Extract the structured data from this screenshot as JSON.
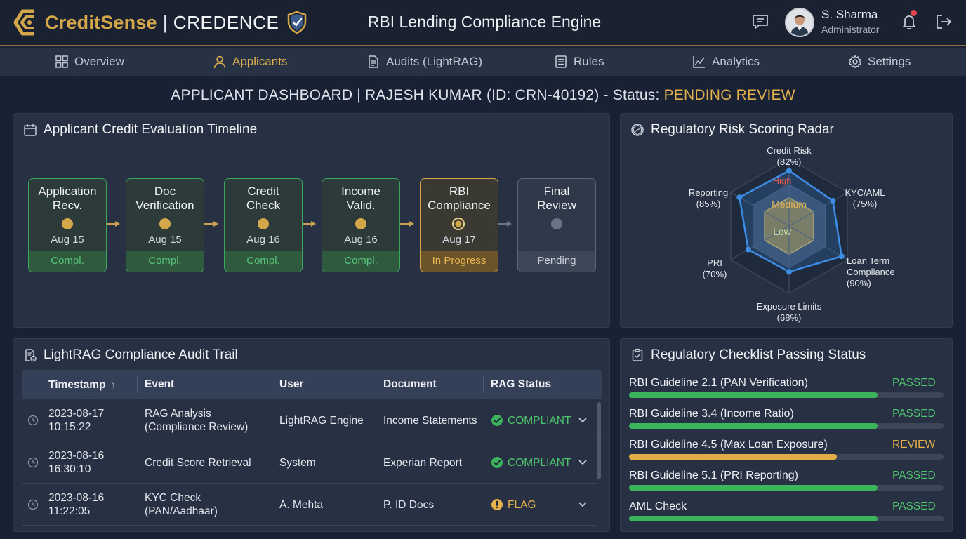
{
  "header": {
    "brand_name": "CreditSense",
    "brand_sep": "|",
    "brand_sub": "CREDENCE",
    "app_title": "RBI Lending Compliance Engine",
    "user_name": "S. Sharma",
    "user_role": "Administrator",
    "icons": [
      "chat-icon",
      "bell-icon",
      "logout-icon"
    ]
  },
  "nav": {
    "active": "Applicants",
    "items": [
      {
        "label": "Overview",
        "icon": "grid-icon"
      },
      {
        "label": "Applicants",
        "icon": "user-icon"
      },
      {
        "label": "Audits (LightRAG)",
        "icon": "document-icon"
      },
      {
        "label": "Rules",
        "icon": "list-icon"
      },
      {
        "label": "Analytics",
        "icon": "chart-icon"
      },
      {
        "label": "Settings",
        "icon": "gear-icon"
      }
    ]
  },
  "page": {
    "heading_prefix": "APPLICANT DASHBOARD |  RAJESH KUMAR (ID: CRN-40192) - Status:",
    "status_value": "PENDING REVIEW"
  },
  "timeline": {
    "title": "Applicant Credit Evaluation Timeline",
    "steps": [
      {
        "label1": "Application",
        "label2": "Recv.",
        "date": "Aug 15",
        "status": "Compl."
      },
      {
        "label1": "Doc",
        "label2": "Verification",
        "date": "Aug 15",
        "status": "Compl."
      },
      {
        "label1": "Credit",
        "label2": "Check",
        "date": "Aug 16",
        "status": "Compl."
      },
      {
        "label1": "Income",
        "label2": "Valid.",
        "date": "Aug 16",
        "status": "Compl."
      },
      {
        "label1": "RBI",
        "label2": "Compliance",
        "date": "Aug 17",
        "status": "In Progress"
      },
      {
        "label1": "Final",
        "label2": "Review",
        "date": "",
        "status": "Pending"
      }
    ],
    "colors": {
      "complete": "#3aa65e",
      "progress": "#d8a64c",
      "pending": "#5d6676"
    }
  },
  "radar": {
    "title": "Regulatory Risk Scoring Radar",
    "zone_labels": {
      "high": "High",
      "medium": "Medium",
      "low": "Low"
    },
    "axes": [
      {
        "name": "Credit Risk",
        "value_text": "(82%)",
        "value": 82
      },
      {
        "name": "KYC/AML",
        "value_text": "(75%)",
        "value": 75
      },
      {
        "name": "Loan Term Compliance",
        "name_lines": [
          "Loan Term",
          "Compliance"
        ],
        "value_text": "(90%)",
        "value": 90
      },
      {
        "name": "Exposure Limits",
        "value_text": "(68%)",
        "value": 68
      },
      {
        "name": "PRI",
        "value_text": "(70%)",
        "value": 70
      },
      {
        "name": "Reporting",
        "value_text": "(85%)",
        "value": 85
      }
    ],
    "colors": {
      "series": "#3d8ce6",
      "low": "#8c7a45",
      "medium": "#3a4a60",
      "high": "#1f2a3c"
    }
  },
  "audit": {
    "title": "LightRAG Compliance Audit Trail",
    "columns": [
      "Timestamp",
      "Event",
      "User",
      "Document",
      "RAG Status"
    ],
    "sort_indicator": "↑",
    "rows": [
      {
        "date": "2023-08-17",
        "time": "10:15:22",
        "event1": "RAG Analysis",
        "event2": "(Compliance Review)",
        "user": "LightRAG Engine",
        "document": "Income Statements",
        "status": "COMPLIANT",
        "kind": "ok"
      },
      {
        "date": "2023-08-16",
        "time": "16:30:10",
        "event1": "Credit Score Retrieval",
        "event2": "",
        "user": "System",
        "document": "Experian Report",
        "status": "COMPLIANT",
        "kind": "ok"
      },
      {
        "date": "2023-08-16",
        "time": "11:22:05",
        "event1": "KYC Check",
        "event2": "(PAN/Aadhaar)",
        "user": "A. Mehta",
        "document": "P. ID Docs",
        "status": "FLAG",
        "kind": "flag"
      }
    ]
  },
  "checklist": {
    "title": "Regulatory Checklist Passing Status",
    "items": [
      {
        "name": "RBI Guideline 2.1 (PAN Verification)",
        "status": "PASSED",
        "progress": 0.79
      },
      {
        "name": "RBI Guideline 3.4 (Income Ratio)",
        "status": "PASSED",
        "progress": 0.79
      },
      {
        "name": "RBI Guideline 4.5 (Max Loan Exposure)",
        "status": "REVIEW",
        "progress": 0.66
      },
      {
        "name": "RBI Guideline 5.1 (PRI Reporting)",
        "status": "PASSED",
        "progress": 0.79
      },
      {
        "name": "AML Check",
        "status": "PASSED",
        "progress": 0.79
      }
    ],
    "colors": {
      "passed": "#3bb45c",
      "review": "#e2ac47"
    }
  }
}
